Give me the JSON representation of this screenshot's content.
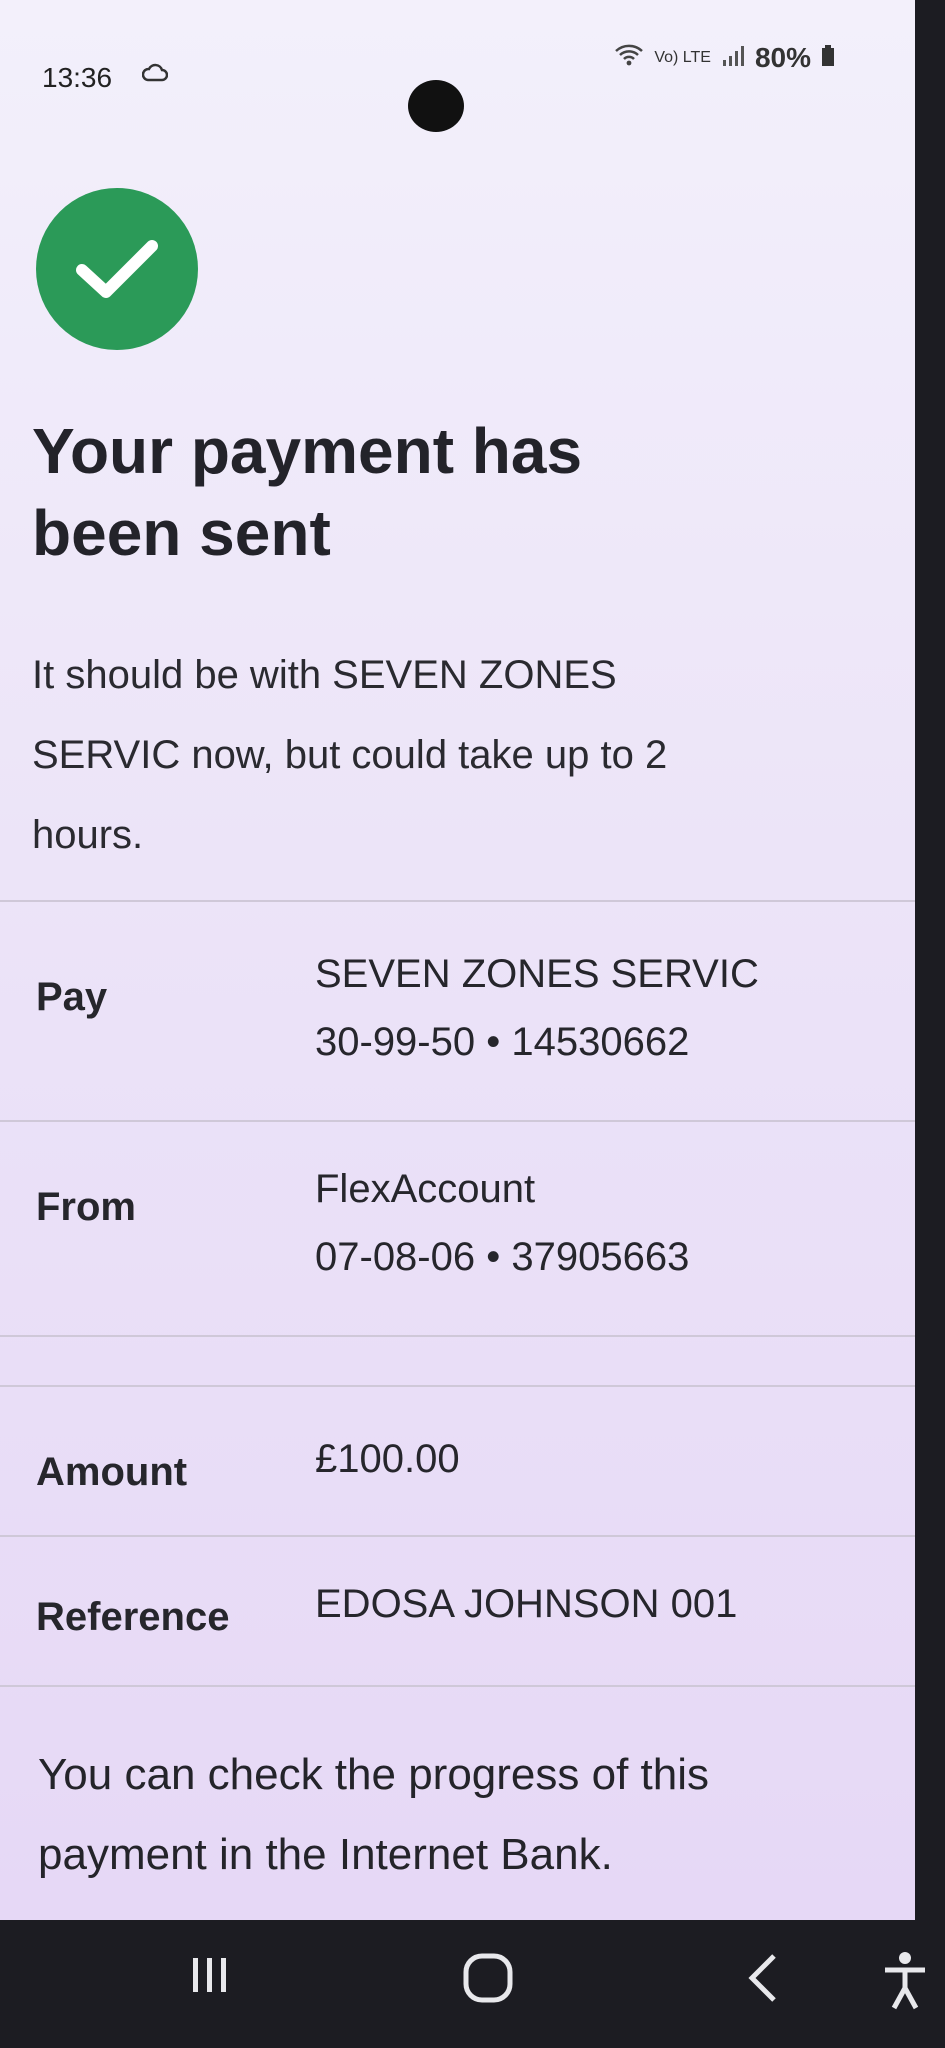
{
  "status": {
    "time": "13:36",
    "battery": "80%",
    "network": "Vo) LTE"
  },
  "colors": {
    "success": "#2b9a58",
    "background": "#ece4f8"
  },
  "heading": {
    "title_line1": "Your payment has",
    "title_line2": "been sent",
    "subtitle_line1": "It should be with SEVEN ZONES",
    "subtitle_line2": "SERVIC now, but could take up to 2",
    "subtitle_line3": "hours."
  },
  "details": {
    "pay": {
      "label": "Pay",
      "name": "SEVEN ZONES SERVIC",
      "account": "30-99-50 • 14530662"
    },
    "from": {
      "label": "From",
      "name": "FlexAccount",
      "account": "07-08-06 • 37905663"
    },
    "amount": {
      "label": "Amount",
      "value": "£100.00"
    },
    "reference": {
      "label": "Reference",
      "value": "EDOSA JOHNSON 001"
    }
  },
  "footer": {
    "line1": "You can check the progress of this",
    "line2": "payment in the Internet Bank."
  },
  "icons": {
    "success": "check-icon",
    "nav_recents": "recents-icon",
    "nav_home": "home-icon",
    "nav_back": "back-icon",
    "accessibility": "accessibility-icon"
  }
}
